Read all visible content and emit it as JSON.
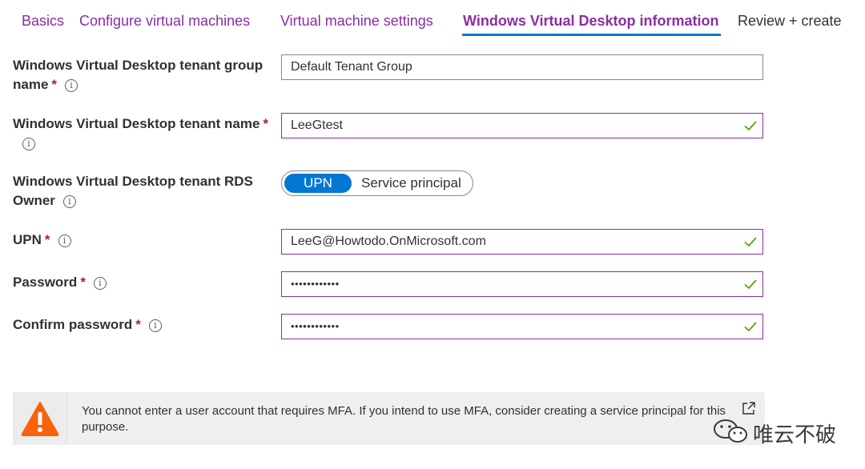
{
  "tabs": [
    {
      "label": "Basics",
      "active": false
    },
    {
      "label": "Configure virtual machines",
      "active": false
    },
    {
      "label": "Virtual machine settings",
      "active": false
    },
    {
      "label": "Windows Virtual Desktop information",
      "active": true
    },
    {
      "label": "Review + create",
      "active": false
    }
  ],
  "form": {
    "tenant_group": {
      "label_line1": "Windows Virtual Desktop tenant group",
      "label_line2": "name",
      "required": "*",
      "value": "Default Tenant Group"
    },
    "tenant_name": {
      "label": "Windows Virtual Desktop tenant name",
      "required": "*",
      "value": "LeeGtest"
    },
    "rds_owner": {
      "label_line1": "Windows Virtual Desktop tenant RDS",
      "label_line2": "Owner",
      "options": [
        "UPN",
        "Service principal"
      ],
      "selected": "UPN"
    },
    "upn": {
      "label": "UPN",
      "required": "*",
      "value": "LeeG@Howtodo.OnMicrosoft.com"
    },
    "password": {
      "label": "Password",
      "required": "*",
      "value": "••••••••••••"
    },
    "confirm_password": {
      "label": "Confirm password",
      "required": "*",
      "value": "••••••••••••"
    }
  },
  "warning": {
    "text": "You cannot enter a user account that requires MFA. If you intend to use MFA, consider creating a service principal for this purpose."
  },
  "watermark": {
    "text": "唯云不破"
  },
  "colors": {
    "accent": "#8a2da5",
    "toggle_selected": "#0078d4",
    "valid_check": "#57a300",
    "required": "#a4262c",
    "warning": "#f7630c"
  },
  "icons": [
    "info-icon",
    "checkmark-icon",
    "warning-icon",
    "external-link-icon",
    "wechat-icon"
  ]
}
